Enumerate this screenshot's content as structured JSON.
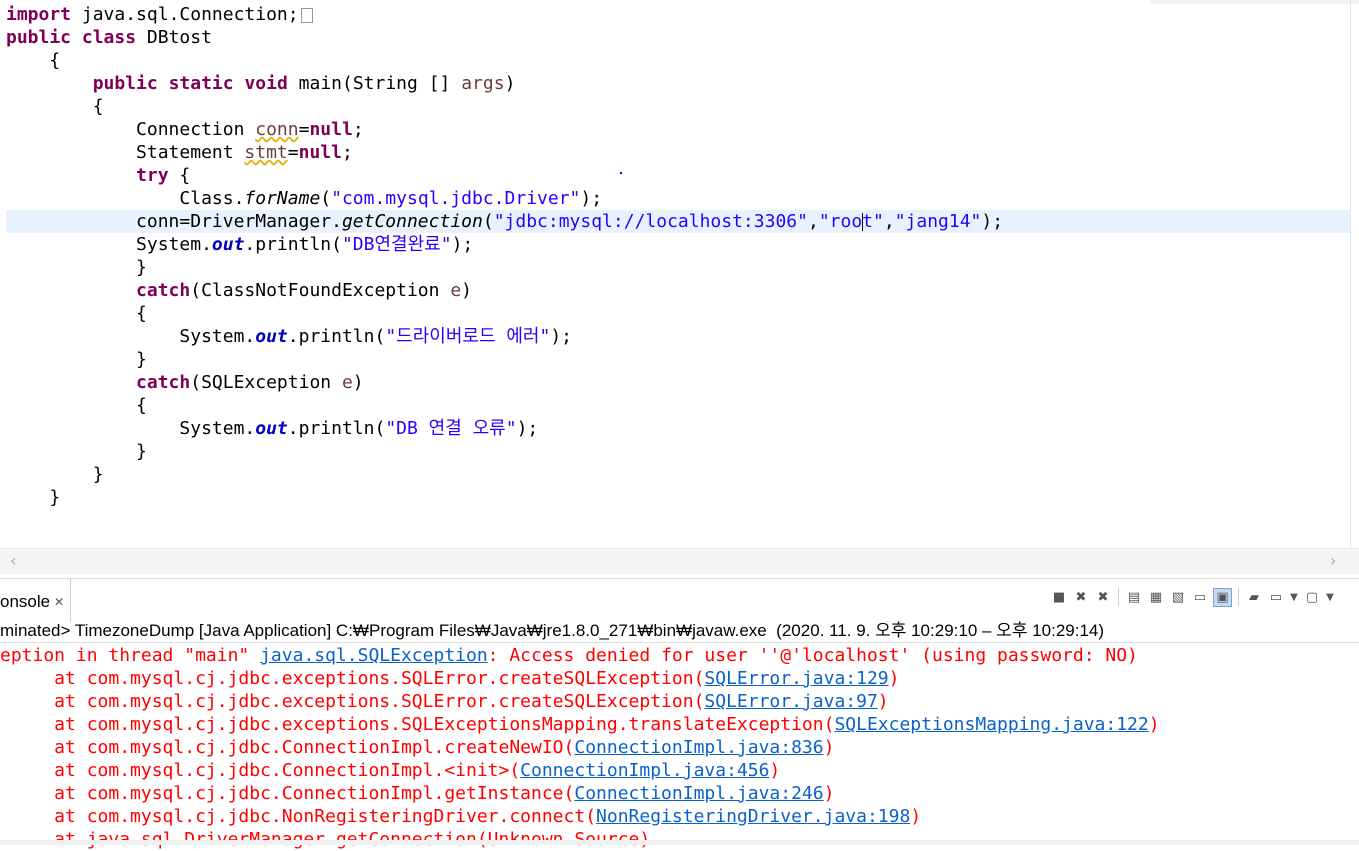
{
  "editor": {
    "lines": [
      {
        "parts": [
          {
            "k": "kw",
            "t": "import"
          },
          {
            "k": "",
            "t": " java.sql.Connection;"
          }
        ]
      },
      {
        "parts": [
          {
            "k": "kw",
            "t": "public"
          },
          {
            "k": "",
            "t": " "
          },
          {
            "k": "kw",
            "t": "class"
          },
          {
            "k": "",
            "t": " DBtost"
          }
        ]
      },
      {
        "parts": [
          {
            "k": "",
            "t": "    {"
          }
        ]
      },
      {
        "parts": [
          {
            "k": "",
            "t": "        "
          },
          {
            "k": "kw",
            "t": "public"
          },
          {
            "k": "",
            "t": " "
          },
          {
            "k": "kw",
            "t": "static"
          },
          {
            "k": "",
            "t": " "
          },
          {
            "k": "kw",
            "t": "void"
          },
          {
            "k": "",
            "t": " main(String [] "
          },
          {
            "k": "param",
            "t": "args"
          },
          {
            "k": "",
            "t": ")"
          }
        ]
      },
      {
        "parts": [
          {
            "k": "",
            "t": "        {"
          }
        ]
      },
      {
        "parts": [
          {
            "k": "",
            "t": "            Connection "
          },
          {
            "k": "warn",
            "t": "conn"
          },
          {
            "k": "",
            "t": "="
          },
          {
            "k": "kw",
            "t": "null"
          },
          {
            "k": "",
            "t": ";"
          }
        ]
      },
      {
        "parts": [
          {
            "k": "",
            "t": "            Statement "
          },
          {
            "k": "warn",
            "t": "stmt"
          },
          {
            "k": "",
            "t": "="
          },
          {
            "k": "kw",
            "t": "null"
          },
          {
            "k": "",
            "t": ";"
          }
        ]
      },
      {
        "parts": [
          {
            "k": "",
            "t": "            "
          },
          {
            "k": "kw",
            "t": "try"
          },
          {
            "k": "",
            "t": " {"
          }
        ]
      },
      {
        "parts": [
          {
            "k": "",
            "t": "                Class."
          },
          {
            "k": "ital",
            "t": "forName"
          },
          {
            "k": "",
            "t": "("
          },
          {
            "k": "str",
            "t": "\"com.mysql.jdbc.Driver\""
          },
          {
            "k": "",
            "t": ");"
          }
        ]
      },
      {
        "parts": [
          {
            "k": "",
            "t": "            conn=DriverManager."
          },
          {
            "k": "ital",
            "t": "getConnection"
          },
          {
            "k": "",
            "t": "("
          },
          {
            "k": "str",
            "t": "\"jdbc:mysql://localhost:3306\""
          },
          {
            "k": "",
            "t": ","
          },
          {
            "k": "str",
            "t": "\"roo"
          },
          {
            "k": "caret",
            "t": ""
          },
          {
            "k": "str",
            "t": "t\""
          },
          {
            "k": "",
            "t": ","
          },
          {
            "k": "str",
            "t": "\"jang14\""
          },
          {
            "k": "",
            "t": ");"
          }
        ]
      },
      {
        "parts": [
          {
            "k": "",
            "t": "            System."
          },
          {
            "k": "fld",
            "t": "out"
          },
          {
            "k": "",
            "t": ".println("
          },
          {
            "k": "str",
            "t": "\"DB연결완료\""
          },
          {
            "k": "",
            "t": ");"
          }
        ]
      },
      {
        "parts": [
          {
            "k": "",
            "t": "            }"
          }
        ]
      },
      {
        "parts": [
          {
            "k": "",
            "t": "            "
          },
          {
            "k": "kw",
            "t": "catch"
          },
          {
            "k": "",
            "t": "(ClassNotFoundException "
          },
          {
            "k": "param",
            "t": "e"
          },
          {
            "k": "",
            "t": ")"
          }
        ]
      },
      {
        "parts": [
          {
            "k": "",
            "t": "            {"
          }
        ]
      },
      {
        "parts": [
          {
            "k": "",
            "t": "                System."
          },
          {
            "k": "fld",
            "t": "out"
          },
          {
            "k": "",
            "t": ".println("
          },
          {
            "k": "str",
            "t": "\"드라이버로드 에러\""
          },
          {
            "k": "",
            "t": ");"
          }
        ]
      },
      {
        "parts": [
          {
            "k": "",
            "t": "            }"
          }
        ]
      },
      {
        "parts": [
          {
            "k": "",
            "t": "            "
          },
          {
            "k": "kw",
            "t": "catch"
          },
          {
            "k": "",
            "t": "(SQLException "
          },
          {
            "k": "param",
            "t": "e"
          },
          {
            "k": "",
            "t": ")"
          }
        ]
      },
      {
        "parts": [
          {
            "k": "",
            "t": "            {"
          }
        ]
      },
      {
        "parts": [
          {
            "k": "",
            "t": "                System."
          },
          {
            "k": "fld",
            "t": "out"
          },
          {
            "k": "",
            "t": ".println("
          },
          {
            "k": "str",
            "t": "\"DB 연결 오류\""
          },
          {
            "k": "",
            "t": ");"
          }
        ]
      },
      {
        "parts": [
          {
            "k": "",
            "t": "            }"
          }
        ]
      },
      {
        "parts": [
          {
            "k": "",
            "t": "        }"
          }
        ]
      },
      {
        "parts": [
          {
            "k": "",
            "t": "    }"
          }
        ]
      }
    ]
  },
  "console": {
    "tab_label": "onsole",
    "tab_close": "✕",
    "status": "minated> TimezoneDump [Java Application] C:₩Program Files₩Java₩jre1.8.0_271₩bin₩javaw.exe  (2020. 11. 9. 오후 10:29:10 – 오후 10:29:14)",
    "output": [
      {
        "parts": [
          {
            "k": "",
            "t": "eption in thread \"main\" "
          },
          {
            "k": "link",
            "t": "java.sql.SQLException"
          },
          {
            "k": "",
            "t": ": Access denied for user ''@'localhost' (using password: NO)"
          }
        ]
      },
      {
        "parts": [
          {
            "k": "",
            "t": "     at com.mysql.cj.jdbc.exceptions.SQLError.createSQLException("
          },
          {
            "k": "link",
            "t": "SQLError.java:129"
          },
          {
            "k": "",
            "t": ")"
          }
        ]
      },
      {
        "parts": [
          {
            "k": "",
            "t": "     at com.mysql.cj.jdbc.exceptions.SQLError.createSQLException("
          },
          {
            "k": "link",
            "t": "SQLError.java:97"
          },
          {
            "k": "",
            "t": ")"
          }
        ]
      },
      {
        "parts": [
          {
            "k": "",
            "t": "     at com.mysql.cj.jdbc.exceptions.SQLExceptionsMapping.translateException("
          },
          {
            "k": "link",
            "t": "SQLExceptionsMapping.java:122"
          },
          {
            "k": "",
            "t": ")"
          }
        ]
      },
      {
        "parts": [
          {
            "k": "",
            "t": "     at com.mysql.cj.jdbc.ConnectionImpl.createNewIO("
          },
          {
            "k": "link",
            "t": "ConnectionImpl.java:836"
          },
          {
            "k": "",
            "t": ")"
          }
        ]
      },
      {
        "parts": [
          {
            "k": "",
            "t": "     at com.mysql.cj.jdbc.ConnectionImpl.<init>("
          },
          {
            "k": "link",
            "t": "ConnectionImpl.java:456"
          },
          {
            "k": "",
            "t": ")"
          }
        ]
      },
      {
        "parts": [
          {
            "k": "",
            "t": "     at com.mysql.cj.jdbc.ConnectionImpl.getInstance("
          },
          {
            "k": "link",
            "t": "ConnectionImpl.java:246"
          },
          {
            "k": "",
            "t": ")"
          }
        ]
      },
      {
        "parts": [
          {
            "k": "",
            "t": "     at com.mysql.cj.jdbc.NonRegisteringDriver.connect("
          },
          {
            "k": "link",
            "t": "NonRegisteringDriver.java:198"
          },
          {
            "k": "",
            "t": ")"
          }
        ]
      },
      {
        "parts": [
          {
            "k": "",
            "t": "     at java.sql.DriverManager.getConnection(Unknown Source)"
          }
        ]
      }
    ]
  },
  "toolbar": {
    "buttons": [
      {
        "name": "terminate-icon",
        "glyph": "■",
        "sel": false
      },
      {
        "name": "remove-launch-icon",
        "glyph": "✖",
        "sel": false
      },
      {
        "name": "remove-all-terminated-icon",
        "glyph": "✖",
        "sel": false
      },
      {
        "name": "sep",
        "glyph": "",
        "sel": false
      },
      {
        "name": "clear-console-icon",
        "glyph": "▤",
        "sel": false
      },
      {
        "name": "scroll-lock-icon",
        "glyph": "▦",
        "sel": false
      },
      {
        "name": "word-wrap-icon",
        "glyph": "▧",
        "sel": false
      },
      {
        "name": "show-on-stdout-icon",
        "glyph": "▭",
        "sel": false
      },
      {
        "name": "show-on-stderr-icon",
        "glyph": "▣",
        "sel": true
      },
      {
        "name": "sep",
        "glyph": "",
        "sel": false
      },
      {
        "name": "pin-console-icon",
        "glyph": "▰",
        "sel": false
      },
      {
        "name": "display-console-icon",
        "glyph": "▭",
        "sel": false
      },
      {
        "name": "display-console-dropdown-icon",
        "glyph": "▼",
        "sel": false
      },
      {
        "name": "open-console-icon",
        "glyph": "▢",
        "sel": false
      },
      {
        "name": "open-console-dropdown-icon",
        "glyph": "▼",
        "sel": false
      }
    ]
  },
  "colors": {
    "keyword": "#7f0055",
    "string": "#2a00ff",
    "static_field": "#0000c0",
    "error_text": "#ff0000",
    "link": "#0b61c8",
    "current_line": "#e8f2fe"
  }
}
